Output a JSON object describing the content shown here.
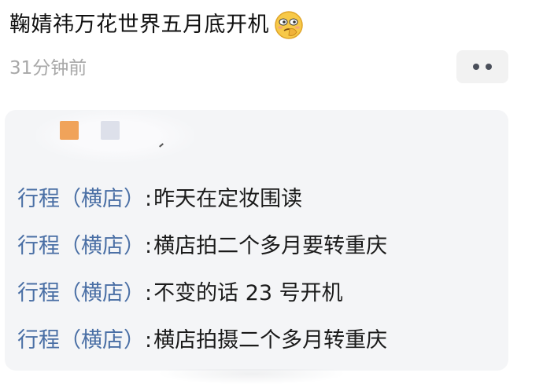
{
  "post": {
    "title": "鞠婧祎万花世界五月底开机",
    "emoji_icon": "thinking-face-emoji-icon",
    "timestamp": "31分钟前"
  },
  "actions": {
    "more_icon": "more-dots-icon"
  },
  "quote": {
    "itinerary": [
      {
        "label": "行程（横店）",
        "colon": ":",
        "text": "昨天在定妆围读"
      },
      {
        "label": "行程（横店）",
        "colon": ":",
        "text": "横店拍二个多月要转重庆"
      },
      {
        "label": "行程（横店）",
        "colon": ":",
        "text": "不变的话 23 号开机"
      },
      {
        "label": "行程（横店）",
        "colon": ":",
        "text": "横店拍摄二个多月转重庆"
      }
    ]
  },
  "colors": {
    "label_blue": "#4a6fa5",
    "timestamp_gray": "#a8a8a8",
    "card_bg": "#f4f5f7",
    "avatar_orange": "#f0a35a"
  }
}
